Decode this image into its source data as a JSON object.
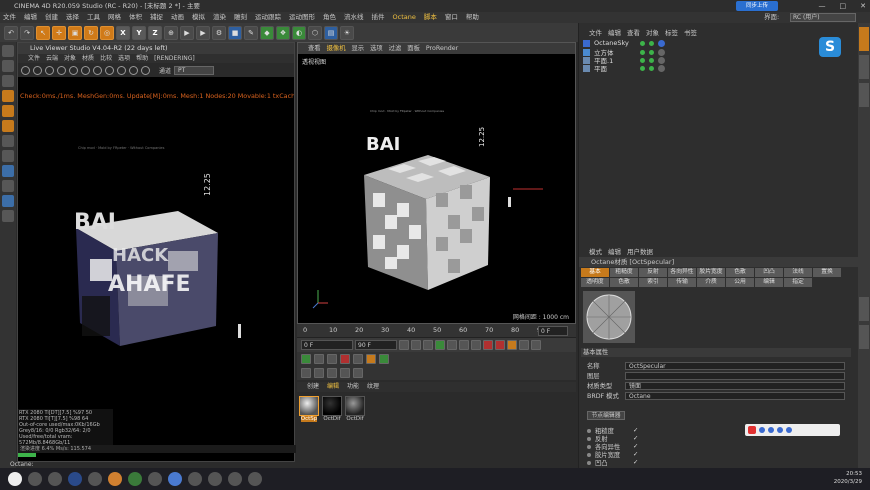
{
  "window": {
    "title": "CINEMA 4D R20.059 Studio (RC - R20) - [未标题 2 *] - 主要",
    "cloud_badge": "同步上传",
    "interface_label": "界面:",
    "interface_value": "RC (用户)"
  },
  "menubar": [
    "文件",
    "编辑",
    "创建",
    "选择",
    "工具",
    "网格",
    "体积",
    "捕捉",
    "动画",
    "模拟",
    "渲染",
    "雕刻",
    "运动跟踪",
    "运动图形",
    "角色",
    "流水线",
    "插件",
    "Octane",
    "脚本",
    "窗口",
    "帮助"
  ],
  "toolbar": {
    "x_label": "X",
    "y_label": "Y",
    "z_label": "Z"
  },
  "live_viewer": {
    "title": "Live Viewer Studio V4.04-R2 (22 days left)",
    "menu": [
      "文件",
      "云端",
      "对象",
      "材质",
      "比较",
      "选项",
      "帮助",
      "[RENDERING]"
    ],
    "channel_label": "通道",
    "channel_value": "PT",
    "status": "Check:0ms./1ms. MeshGen:0ms. Update[M]:0ms. Mesh:1 Nodes:20 Movable:1 txCached:1",
    "gpu_lines": [
      "RTX 2080 Ti[DT][7.5]   %97   50",
      "RTX 2080 Ti[T][7.5]    %98   64",
      "Out-of-core used/max:0Kb/16Gb",
      "Grey8/16: 0/0     Rgb32/64: 2/0",
      "Used/free/total vram: 572Mb/8.8468Gb/11"
    ],
    "bottom_status": "渲染进度 6.4%   Ms/s: 115.574"
  },
  "viewport": {
    "tabs": [
      "查看",
      "摄像机",
      "显示",
      "选项",
      "过滤",
      "面板",
      "ProRender"
    ],
    "label": "透视视图",
    "grid_info": "网格间距 : 1000 cm",
    "scene_text": {
      "title": "BAI",
      "sub1": "HACK",
      "sub2": "AHAFE",
      "number": "12.25"
    }
  },
  "timeline": {
    "ticks": [
      "0",
      "10",
      "20",
      "30",
      "40",
      "50",
      "60",
      "70",
      "80",
      "90"
    ],
    "current_frame": "0 F",
    "start": "0 F",
    "end": "90 F",
    "end2": "0 F"
  },
  "materials": {
    "tabs": [
      "创建",
      "编辑",
      "功能",
      "纹理"
    ],
    "items": [
      {
        "label": "OctSp",
        "active": true
      },
      {
        "label": "OctDif",
        "active": false
      },
      {
        "label": "OctDif",
        "active": false
      }
    ]
  },
  "object_manager": {
    "menu": [
      "文件",
      "编辑",
      "查看",
      "对象",
      "标签",
      "书签"
    ],
    "objects": [
      "OctaneSky",
      "立方体",
      "平面.1",
      "平面"
    ]
  },
  "attributes": {
    "menu": [
      "模式",
      "编辑",
      "用户数据"
    ],
    "title": "Octane材质 [OctSpecular]",
    "channels": [
      "基本",
      "粗糙度",
      "反射",
      "各向异性",
      "胶片宽度",
      "色散",
      "凹凸",
      "法线",
      "置换",
      "透明度",
      "色散",
      "索引",
      "传输",
      "介质",
      "公用",
      "编辑",
      "指定"
    ],
    "section": "基本属性",
    "props": [
      {
        "label": "名称",
        "value": "OctSpecular"
      },
      {
        "label": "图层",
        "value": ""
      },
      {
        "label": "材质类型",
        "value": "镜面"
      },
      {
        "label": "BRDF 模式",
        "value": "Octane"
      }
    ],
    "node_editor_btn": "节点编辑器",
    "checks": [
      "粗糙度",
      "反射",
      "各向异性",
      "胶片宽度",
      "凹凸"
    ]
  },
  "taskbar": {
    "time": "20:53",
    "date": "2020/3/29"
  },
  "status_bottom": "Octane:"
}
